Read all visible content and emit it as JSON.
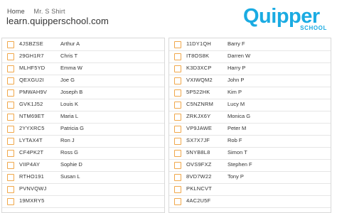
{
  "breadcrumb": {
    "home": "Home",
    "current": "Mr. S Shirt"
  },
  "site_url": "learn.quipperschool.com",
  "logo": {
    "main": "Quipper",
    "sub": "SCHOOL"
  },
  "colors": {
    "logo": "#1aabe2",
    "checkbox_border": "#f0a74a"
  },
  "left_column": [
    {
      "code": "4JSBZSE",
      "name": "Arthur A"
    },
    {
      "code": "29GH1R7",
      "name": "Chris T"
    },
    {
      "code": "MLHF5YD",
      "name": "Emma W"
    },
    {
      "code": "QEXGU2I",
      "name": "Joe G"
    },
    {
      "code": "PMWAH9V",
      "name": "Joseph B"
    },
    {
      "code": "GVK1J52",
      "name": "Louis K"
    },
    {
      "code": "NTM69ET",
      "name": "Maria L"
    },
    {
      "code": "2YYXRC5",
      "name": "Patricia G"
    },
    {
      "code": "LYTAX4T",
      "name": "Ron J"
    },
    {
      "code": "CF4PK2T",
      "name": "Ross G"
    },
    {
      "code": "VIIP4AY",
      "name": "Sophie D"
    },
    {
      "code": "RTHO191",
      "name": "Susan L"
    },
    {
      "code": "PVNVQWJ",
      "name": ""
    },
    {
      "code": "19MXRY5",
      "name": ""
    }
  ],
  "right_column": [
    {
      "code": "11DY1QH",
      "name": "Barry F"
    },
    {
      "code": "IT8OS8K",
      "name": "Darren W"
    },
    {
      "code": "K3D3XCP",
      "name": "Harry P"
    },
    {
      "code": "VXIWQM2",
      "name": "John P"
    },
    {
      "code": "5P522HK",
      "name": "Kim P"
    },
    {
      "code": "C5NZNRM",
      "name": "Lucy M"
    },
    {
      "code": "ZRKJX6Y",
      "name": "Monica G"
    },
    {
      "code": "VP9JAWE",
      "name": "Peter M"
    },
    {
      "code": "SX7X7JF",
      "name": "Rob F"
    },
    {
      "code": "5NYB8L8",
      "name": "Simon T"
    },
    {
      "code": "OVS9FXZ",
      "name": "Stephen F"
    },
    {
      "code": "8VD7W22",
      "name": "Tony P"
    },
    {
      "code": "PKLNCVT",
      "name": ""
    },
    {
      "code": "4AC2U5F",
      "name": ""
    }
  ]
}
